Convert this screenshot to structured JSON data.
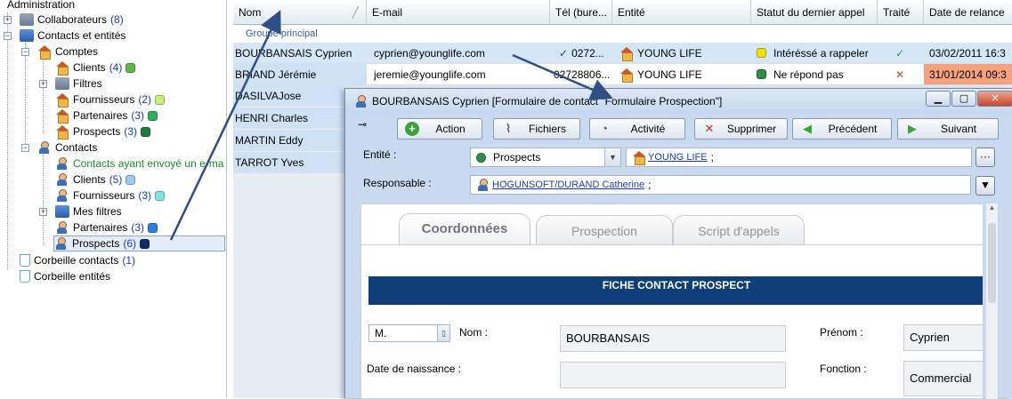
{
  "tree": {
    "items": [
      {
        "label": "Administration",
        "count": "",
        "color": ""
      },
      {
        "label": "Collaborateurs",
        "count": "(8)",
        "color": ""
      },
      {
        "label": "Contacts et entités",
        "count": "",
        "color": ""
      },
      {
        "label": "Comptes",
        "count": "",
        "color": ""
      },
      {
        "label": "Clients",
        "count": "(4)",
        "color": "#5fb64a"
      },
      {
        "label": "Filtres",
        "count": "",
        "color": ""
      },
      {
        "label": "Fournisseurs",
        "count": "(2)",
        "color": "#c9ef7b"
      },
      {
        "label": "Partenaires",
        "count": "(3)",
        "color": "#2fad5c"
      },
      {
        "label": "Prospects",
        "count": "(3)",
        "color": "#1f7a3c"
      },
      {
        "label": "Contacts",
        "count": "",
        "color": ""
      },
      {
        "label": "Contacts ayant envoyé un e-ma",
        "count": "",
        "color": ""
      },
      {
        "label": "Clients",
        "count": "(5)",
        "color": "#9ec9f2"
      },
      {
        "label": "Fournisseurs",
        "count": "(3)",
        "color": "#7fe5e2"
      },
      {
        "label": "Mes filtres",
        "count": "",
        "color": ""
      },
      {
        "label": "Partenaires",
        "count": "(3)",
        "color": "#2b7fd8"
      },
      {
        "label": "Prospects",
        "count": "(6)",
        "color": "#0b2e66"
      },
      {
        "label": "Corbeille contacts",
        "count": "(1)",
        "color": ""
      },
      {
        "label": "Corbeille entités",
        "count": "",
        "color": ""
      }
    ]
  },
  "grid": {
    "columns": [
      "Nom",
      "E-mail",
      "Tél (bure...",
      "Entité",
      "Statut du dernier appel",
      "Traité",
      "Date de relance"
    ],
    "group": "Groupe principal",
    "rows": [
      {
        "name": "BOURBANSAIS Cyprien",
        "email": "cyprien@younglife.com",
        "tel": "0272...",
        "entity": "YOUNG LIFE",
        "status": "Intéréssé a rappeler",
        "status_color": "#f4e300",
        "treated": "✓",
        "date": "03/02/2011 16:3"
      },
      {
        "name": "BRIAND Jérémie",
        "email": "jeremie@younglife.com",
        "tel": "02728806...",
        "entity": "YOUNG LIFE",
        "status": "Ne répond pas",
        "status_color": "#2f8f4a",
        "treated": "✕",
        "date": "31/01/2014 09:3"
      },
      {
        "name": "DASILVAJose",
        "email": "",
        "tel": "",
        "entity": "",
        "status": "",
        "status_color": "",
        "treated": "",
        "date": ""
      },
      {
        "name": "HENRI Charles",
        "email": "",
        "tel": "",
        "entity": "",
        "status": "",
        "status_color": "",
        "treated": "",
        "date": ""
      },
      {
        "name": "MARTIN Eddy",
        "email": "",
        "tel": "",
        "entity": "",
        "status": "",
        "status_color": "",
        "treated": "",
        "date": ""
      },
      {
        "name": "TARROT Yves",
        "email": "",
        "tel": "",
        "entity": "",
        "status": "",
        "status_color": "",
        "treated": "",
        "date": ""
      }
    ]
  },
  "dialog": {
    "title": "BOURBANSAIS Cyprien [Formulaire de contact \"Formulaire Prospection\"]",
    "toolbar": {
      "action": "Action",
      "files": "Fichiers",
      "activity": "Activité",
      "delete": "Supprimer",
      "previous": "Précédent",
      "next": "Suivant"
    },
    "entity_label": "Entité :",
    "entity_type": "Prospects",
    "entity_link": "YOUNG LIFE",
    "entity_suffix": ";",
    "responsible_label": "Responsable :",
    "responsible_link": "HOGUNSOFT/DURAND Catherine",
    "responsible_suffix": ";",
    "tabs": [
      "Coordonnées",
      "Prospection",
      "Script d'appels"
    ],
    "banner": "FICHE CONTACT PROSPECT",
    "civility": "M.",
    "nom_label": "Nom :",
    "nom_value": "BOURBANSAIS",
    "prenom_label": "Prénom :",
    "prenom_value": "Cyprien",
    "birth_label": "Date de naissance :",
    "birth_value": "",
    "fonction_label": "Fonction :",
    "fonction_value": "Commercial"
  },
  "colors": {
    "accent": "#0e3f7a",
    "selection": "#d5e6f7",
    "date_highlight": "#f4a27e"
  }
}
